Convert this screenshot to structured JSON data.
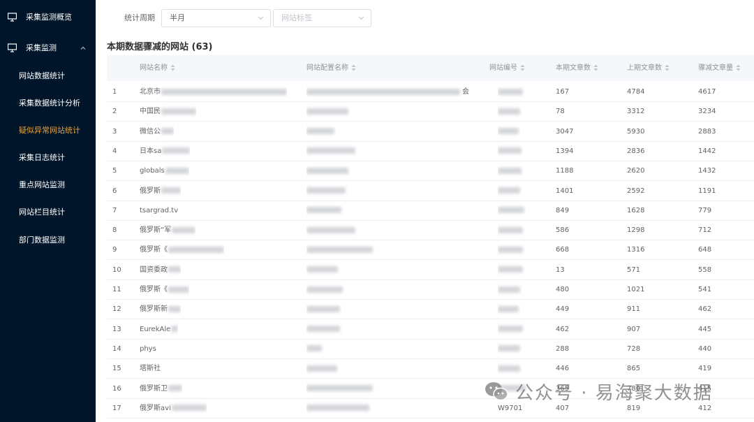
{
  "sidebar": {
    "top_item": {
      "label": "采集监测概览",
      "icon": "monitor-icon"
    },
    "group": {
      "label": "采集监测",
      "icon": "monitor-icon",
      "expanded": true
    },
    "items": [
      {
        "label": "网站数据统计",
        "active": false
      },
      {
        "label": "采集数据统计分析",
        "active": false
      },
      {
        "label": "疑似异常网站统计",
        "active": true
      },
      {
        "label": "采集日志统计",
        "active": false
      },
      {
        "label": "重点网站监测",
        "active": false
      },
      {
        "label": "网站栏目统计",
        "active": false
      },
      {
        "label": "部门数据监测",
        "active": false
      }
    ],
    "active_color": "#e6a23c",
    "bg_color": "#001529"
  },
  "filters": {
    "period_label": "统计周期",
    "period_value": "半月",
    "site_tag_placeholder": "网站标签"
  },
  "section": {
    "title": "本期数据骤减的网站 (63)"
  },
  "table": {
    "columns": [
      "网站名称",
      "网站配置名称",
      "网站编号",
      "本期文章数",
      "上期文章数",
      "骤减文章量"
    ],
    "rows": [
      {
        "idx": "1",
        "name": "北京市",
        "config": "会",
        "code": "",
        "current": "167",
        "previous": "4784",
        "drop": "4617"
      },
      {
        "idx": "2",
        "name": "中国民",
        "config": "",
        "code": "",
        "current": "78",
        "previous": "3312",
        "drop": "3234"
      },
      {
        "idx": "3",
        "name": "微信公",
        "config": "",
        "code": "",
        "current": "3047",
        "previous": "5930",
        "drop": "2883"
      },
      {
        "idx": "4",
        "name": "日本sa",
        "config": "",
        "code": "",
        "current": "1394",
        "previous": "2836",
        "drop": "1442"
      },
      {
        "idx": "5",
        "name": "globals",
        "config": "",
        "code": "",
        "current": "1188",
        "previous": "2620",
        "drop": "1432"
      },
      {
        "idx": "6",
        "name": "俄罗斯",
        "config": "",
        "code": "",
        "current": "1401",
        "previous": "2592",
        "drop": "1191"
      },
      {
        "idx": "7",
        "name": "tsargrad.tv",
        "config": "",
        "code": "",
        "current": "849",
        "previous": "1628",
        "drop": "779"
      },
      {
        "idx": "8",
        "name": "俄罗斯“军",
        "config": "",
        "code": "",
        "current": "586",
        "previous": "1298",
        "drop": "712"
      },
      {
        "idx": "9",
        "name": "俄罗斯《",
        "config": "",
        "code": "",
        "current": "668",
        "previous": "1316",
        "drop": "648"
      },
      {
        "idx": "10",
        "name": "国资委政",
        "config": "",
        "code": "",
        "current": "13",
        "previous": "571",
        "drop": "558"
      },
      {
        "idx": "11",
        "name": "俄罗斯《",
        "config": "",
        "code": "",
        "current": "480",
        "previous": "1021",
        "drop": "541"
      },
      {
        "idx": "12",
        "name": "俄罗斯新",
        "config": "",
        "code": "",
        "current": "449",
        "previous": "911",
        "drop": "462"
      },
      {
        "idx": "13",
        "name": "EurekAle",
        "config": "",
        "code": "",
        "current": "462",
        "previous": "907",
        "drop": "445"
      },
      {
        "idx": "14",
        "name": "phys",
        "config": "",
        "code": "",
        "current": "288",
        "previous": "728",
        "drop": "440"
      },
      {
        "idx": "15",
        "name": "塔斯社",
        "config": "",
        "code": "",
        "current": "446",
        "previous": "865",
        "drop": "419"
      },
      {
        "idx": "16",
        "name": "俄罗斯卫",
        "config": "",
        "code": "",
        "current": "365",
        "previous": "780",
        "drop": "415"
      },
      {
        "idx": "17",
        "name": "俄罗斯avi",
        "config": "",
        "code": "W9701",
        "current": "407",
        "previous": "819",
        "drop": "412"
      }
    ]
  },
  "watermark": {
    "text": "公众号 · 易海聚大数据",
    "icon": "wechat-icon"
  }
}
